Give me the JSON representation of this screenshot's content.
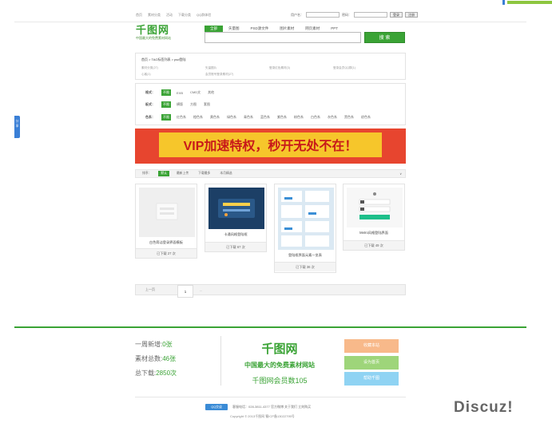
{
  "topbar": {
    "brand": "Discuz!"
  },
  "header": {
    "links": [
      "首页",
      "素材分类",
      "活动",
      "下载分类",
      "QQ群体验"
    ],
    "username_label": "用户名：",
    "password_label": "密码：",
    "login_button": "登录",
    "register_button": "注册"
  },
  "logo": {
    "title": "千图网",
    "subtitle": "中国最大的免费素材网站"
  },
  "search": {
    "tabs": [
      "全部",
      "矢量图",
      "PSD源文件",
      "图片素材",
      "网页素材",
      "PPT"
    ],
    "button": "搜 索"
  },
  "breadcrumb": "首页 > TAG标签列表 > psd登陆",
  "related": [
    "素材分类(27)",
    "矢量图片",
    "登录红色素材(3)",
    "登录会员QQ群(1)",
    "心客(1)",
    "会员账号登录素材(27)"
  ],
  "filters": {
    "style": {
      "label": "格式：",
      "options": [
        "不限",
        "EXB",
        "CMD文",
        "其他"
      ]
    },
    "board": {
      "label": "板式：",
      "options": [
        "不限",
        "横版",
        "方图",
        "套图"
      ]
    },
    "color": {
      "label": "色系：",
      "options": [
        "不限",
        "红色系",
        "橙色系",
        "黄色系",
        "绿色系",
        "青色系",
        "蓝色系",
        "紫色系",
        "粉色系",
        "白色系",
        "灰色系",
        "黑色系",
        "综色系"
      ]
    }
  },
  "banner": {
    "text": "VIP加速特权，秒开无处不在！"
  },
  "sort": {
    "label": "排序：",
    "options": [
      "默认",
      "最新上传",
      "下载最多",
      "本月精选"
    ],
    "more": "∨"
  },
  "cards": [
    {
      "title": "白色简洁登录界面模板",
      "downloads": "已下载 27 次"
    },
    {
      "title": "卡通风格登陆框",
      "downloads": "已下载 67 次"
    },
    {
      "title": "登陆框界面元素一览表",
      "downloads": "已下载 36 次"
    },
    {
      "title": "Metro风格登陆界面",
      "downloads": "已下载 49 次"
    }
  ],
  "pager": {
    "prev": "上一页",
    "current": "1",
    "ellipsis": "..."
  },
  "footer": {
    "weekly_label": "一周新增:",
    "weekly_value": "0张",
    "total_label": "素材总数:",
    "total_value": "46张",
    "downloads_label": "总下载:",
    "downloads_value": "2850次",
    "logo_title": "千图网",
    "slogan": "中国最大的免费素材网站",
    "members": "千图网会员数105",
    "btn_bookmark": "收藏本站",
    "btn_home": "设为首页",
    "btn_help": "帮助千图",
    "qq_badge": "QQ交谈",
    "contact": "客服电话：028-3811-4377  官方微博  关于我们  立刻购买",
    "copyright": "Copyright © 2013千图网 蜀ICP备13022795号"
  },
  "side_tab": "分享",
  "watermark": "Discuz!",
  "colors": {
    "accent": "#3aa335",
    "banner_bg": "#e7452f",
    "banner_strip": "#f6c62b"
  }
}
